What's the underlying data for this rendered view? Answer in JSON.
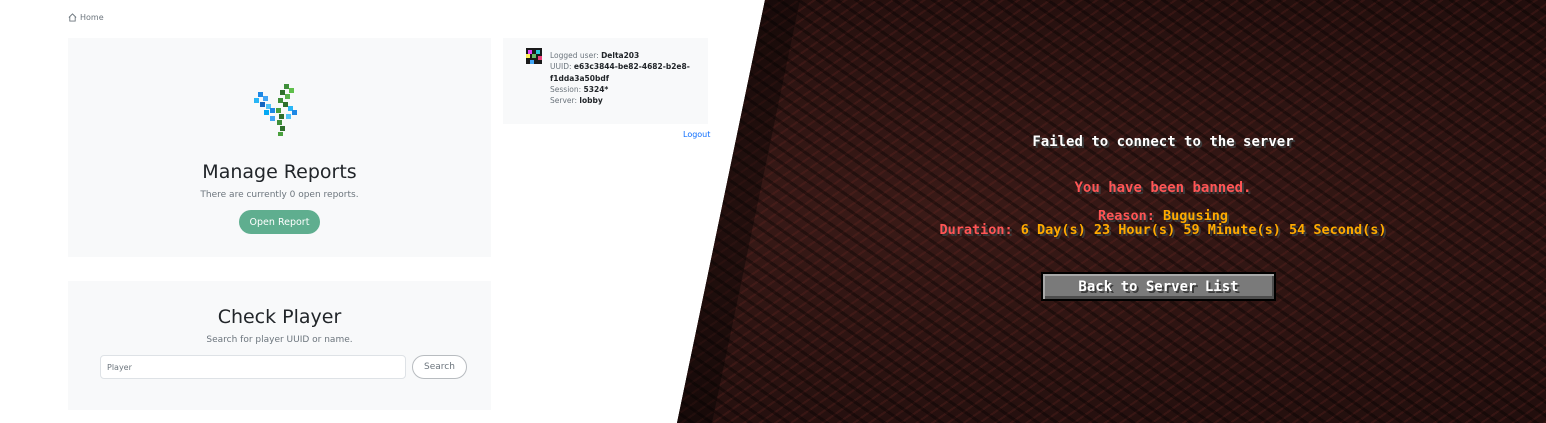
{
  "breadcrumb": {
    "home_label": "Home"
  },
  "reports": {
    "title": "Manage Reports",
    "subtitle": "There are currently 0 open reports.",
    "button_label": "Open Report"
  },
  "check": {
    "title": "Check Player",
    "subtitle": "Search for player UUID or name.",
    "input_placeholder": "Player",
    "search_label": "Search"
  },
  "user": {
    "logged_label": "Logged user:",
    "logged_value": "Delta203",
    "uuid_label": "UUID:",
    "uuid_value": "e63c3844-be82-4682-b2e8-f1dda3a50bdf",
    "session_label": "Session:",
    "session_value": "5324*",
    "server_label": "Server:",
    "server_value": "lobby",
    "logout_label": "Logout"
  },
  "minecraft": {
    "failed_text": "Failed to connect to the server",
    "banned_text": "You have been banned.",
    "reason_label": "Reason:",
    "reason_value": "Bugusing",
    "duration_label": "Duration:",
    "duration_value": "6 Day(s) 23 Hour(s) 59 Minute(s) 54 Second(s)",
    "back_button_label": "Back to Server List"
  },
  "colors": {
    "accent_green": "#5fae8f",
    "link_blue": "#0d6efd",
    "mc_red": "#ff5555",
    "mc_gold": "#ffaa00"
  }
}
